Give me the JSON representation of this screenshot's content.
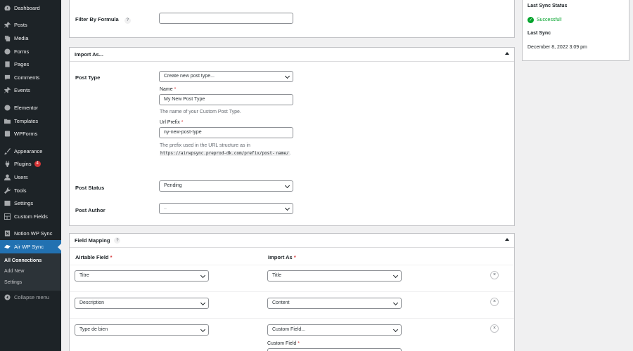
{
  "sidebar": {
    "items": [
      {
        "label": "Dashboard",
        "icon": "dashboard-icon"
      },
      {
        "label": "Posts",
        "icon": "pin-icon"
      },
      {
        "label": "Media",
        "icon": "media-icon"
      },
      {
        "label": "Forms",
        "icon": "forms-icon"
      },
      {
        "label": "Pages",
        "icon": "pages-icon"
      },
      {
        "label": "Comments",
        "icon": "comments-icon"
      },
      {
        "label": "Events",
        "icon": "pin-icon"
      },
      {
        "label": "Elementor",
        "icon": "elementor-icon"
      },
      {
        "label": "Templates",
        "icon": "folder-icon"
      },
      {
        "label": "WPForms",
        "icon": "wpforms-icon"
      },
      {
        "label": "Appearance",
        "icon": "brush-icon"
      },
      {
        "label": "Plugins",
        "icon": "plugin-icon",
        "badge": "4"
      },
      {
        "label": "Users",
        "icon": "users-icon"
      },
      {
        "label": "Tools",
        "icon": "wrench-icon"
      },
      {
        "label": "Settings",
        "icon": "settings-icon"
      },
      {
        "label": "Custom Fields",
        "icon": "grid-icon"
      },
      {
        "label": "Notion WP Sync",
        "icon": "notion-icon"
      },
      {
        "label": "Air WP Sync",
        "icon": "cloud-icon"
      }
    ],
    "submenu": [
      "All Connections",
      "Add New",
      "Settings"
    ],
    "collapse_label": "Collapse menu"
  },
  "filter": {
    "label": "Filter By Formula",
    "help": "?",
    "value": ""
  },
  "import_as": {
    "title": "Import As...",
    "post_type_label": "Post Type",
    "post_type_value": "Create new post type...",
    "name_label": "Name",
    "name_value": "My New Post Type",
    "name_desc": "The name of your Custom Post Type.",
    "url_prefix_label": "Url Prefix",
    "url_prefix_value": "ny-new-post-type",
    "url_desc": "The prefix used in the URL structure as in",
    "url_code_1": "https://airwpsync.preprod-dk.com/prefix/post-",
    "url_code_2": "name/",
    "url_desc_end": ".",
    "required_mark": "*",
    "post_status_label": "Post Status",
    "post_status_value": "Pending",
    "post_author_label": "Post Author",
    "post_author_value": ".."
  },
  "field_mapping": {
    "title": "Field Mapping",
    "help": "?",
    "col_airtable": "Airtable Field",
    "col_import": "Import As",
    "required_mark": "*",
    "rows": [
      {
        "airtable": "Titre",
        "import": "Title"
      },
      {
        "airtable": "Description",
        "import": "Content"
      },
      {
        "airtable": "Type de bien",
        "import": "Custom Field..."
      }
    ],
    "custom_field_label": "Custom Field",
    "remove_label": "×"
  },
  "sync_status": {
    "last_status_label": "Last Sync Status",
    "status_text": "Successful!",
    "last_sync_label": "Last Sync",
    "last_sync_value": "December 8, 2022 3:09 pm"
  },
  "colors": {
    "sidebar_bg": "#1d2327",
    "accent": "#2271b1",
    "success": "#00a32a",
    "required": "#d63638"
  }
}
